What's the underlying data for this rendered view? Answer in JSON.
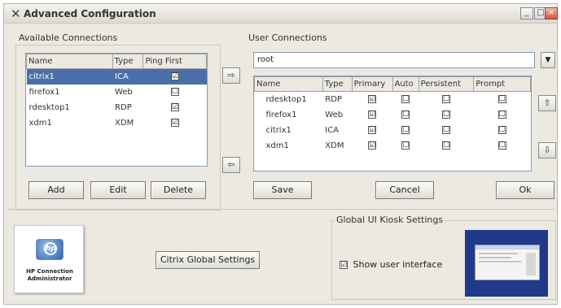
{
  "window": {
    "title": "Advanced Configuration",
    "controls": {
      "minimize": "_",
      "maximize": "□",
      "close": "×"
    }
  },
  "available": {
    "label": "Available Connections",
    "columns": [
      "Name",
      "Type",
      "Ping First"
    ],
    "rows": [
      {
        "name": "citrix1",
        "type": "ICA",
        "ping": "☑"
      },
      {
        "name": "firefox1",
        "type": "Web",
        "ping": "☐"
      },
      {
        "name": "rdesktop1",
        "type": "RDP",
        "ping": "☑"
      },
      {
        "name": "xdm1",
        "type": "XDM",
        "ping": "☑"
      }
    ],
    "buttons": {
      "add": "Add",
      "edit": "Edit",
      "delete": "Delete"
    }
  },
  "transfer": {
    "right": "⇨",
    "left": "⇦"
  },
  "user": {
    "label": "User Connections",
    "selected_user": "root",
    "columns": [
      "Name",
      "Type",
      "Primary",
      "Auto",
      "Persistent",
      "Prompt"
    ],
    "rows": [
      {
        "name": "rdesktop1",
        "type": "RDP",
        "primary": "☑",
        "auto": "☐",
        "persistent": "☐",
        "prompt": "☐"
      },
      {
        "name": "firefox1",
        "type": "Web",
        "primary": "☑",
        "auto": "☐",
        "persistent": "☐",
        "prompt": "☐"
      },
      {
        "name": "citrix1",
        "type": "ICA",
        "primary": "☑",
        "auto": "☐",
        "persistent": "☐",
        "prompt": "☐"
      },
      {
        "name": "xdm1",
        "type": "XDM",
        "primary": "☑",
        "auto": "☐",
        "persistent": "☐",
        "prompt": "☐"
      }
    ],
    "order_up": "⇧",
    "order_down": "⇩",
    "buttons": {
      "save": "Save",
      "cancel": "Cancel",
      "ok": "Ok"
    }
  },
  "logo": {
    "line1": "HP Connection",
    "line2": "Administrator"
  },
  "citrix_button": "Citrix Global Settings",
  "kiosk": {
    "label": "Global UI Kiosk Settings",
    "checkbox_mark": "☑",
    "checkbox_label": "Show user interface"
  },
  "colors": {
    "selection": "#4a6fa8",
    "preview_frame": "#1f3a8a",
    "window_bg": "#ece9e0"
  }
}
